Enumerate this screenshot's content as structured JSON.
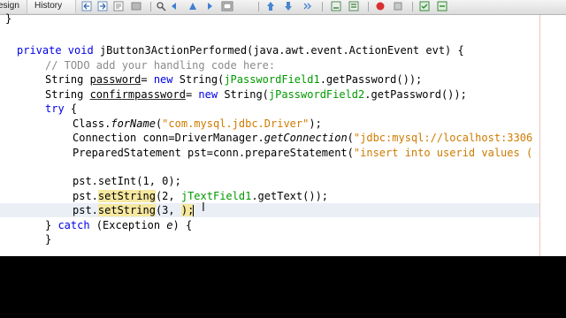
{
  "tabs": {
    "design": "esign",
    "history": "History"
  },
  "toolbar_icons": [
    "back-icon",
    "forward-icon",
    "find-icon",
    "find-prev-icon",
    "find-next-icon",
    "toggle-highlight-icon",
    "toggle-bookmark-icon",
    "prev-bookmark-icon",
    "next-bookmark-icon",
    "shift-left-icon",
    "shift-right-icon",
    "record-macro-icon",
    "stop-macro-icon",
    "comment-icon",
    "uncomment-icon"
  ],
  "colors": {
    "keyword": "#0000e6",
    "comment": "#8a8a8a",
    "string": "#ce7b00",
    "field": "#009900",
    "highlight": "#f6e8a0"
  },
  "code": {
    "line0": "}",
    "l1_kw": "private void ",
    "l1_rest": "jButton3ActionPerformed(java.awt.event.ActionEvent evt) {",
    "l2": "// TODO add your handling code here:",
    "l3_a": "String ",
    "l3_var": "password",
    "l3_b": "= ",
    "l3_new": "new",
    "l3_c": " String(",
    "l3_fld": "jPasswordField1",
    "l3_d": ".getPassword());",
    "l4_a": "String ",
    "l4_var": "confirmpassword",
    "l4_b": "= ",
    "l4_new": "new",
    "l4_c": " String(",
    "l4_fld": "jPasswordField2",
    "l4_d": ".getPassword());",
    "l5_try": "try",
    "l5_b": " {",
    "l6_a": "Class.",
    "l6_it": "forName",
    "l6_b": "(",
    "l6_str": "\"com.mysql.jdbc.Driver\"",
    "l6_c": ");",
    "l7_a": "Connection conn=DriverManager.",
    "l7_it": "getConnection",
    "l7_b": "(",
    "l7_str": "\"jdbc:mysql://localhost:3306",
    "l8_a": "PreparedStatement pst=conn.prepareStatement(",
    "l8_str": "\"insert into userid values (",
    "l10": "pst.setInt(1, 0);",
    "l11_a": "pst.",
    "l11_hl": "setString",
    "l11_b": "(2, ",
    "l11_fld": "jTextField1",
    "l11_c": ".getText());",
    "l12_a": "pst.",
    "l12_hl": "setString",
    "l12_b": "(3, ",
    "l12_c": ");",
    "l13_a": "} ",
    "l13_catch": "catch",
    "l13_b": " (Exception ",
    "l13_e": "e",
    "l13_c": ") {",
    "l14": "}"
  }
}
